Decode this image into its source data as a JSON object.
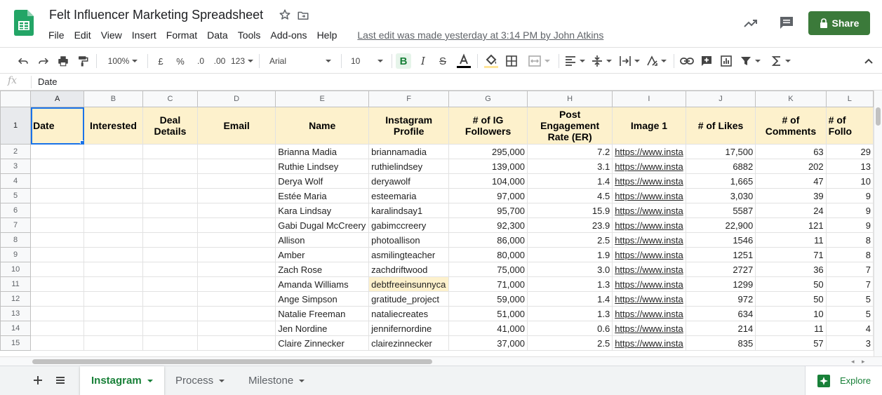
{
  "doc": {
    "title": "Felt Influencer Marketing Spreadsheet",
    "last_edit": "Last edit was made yesterday at 3:14 PM by John Atkins",
    "share_label": "Share"
  },
  "menu": [
    "File",
    "Edit",
    "View",
    "Insert",
    "Format",
    "Data",
    "Tools",
    "Add-ons",
    "Help"
  ],
  "toolbar": {
    "zoom": "100%",
    "currency": "£",
    "percent": "%",
    "dec_less": ".0",
    "dec_more": ".00",
    "more_formats": "123",
    "font": "Arial",
    "font_size": "10"
  },
  "formula_bar": {
    "fx": "fx",
    "value": "Date"
  },
  "columns": [
    "A",
    "B",
    "C",
    "D",
    "E",
    "F",
    "G",
    "H",
    "I",
    "J",
    "K",
    "L"
  ],
  "header_row": {
    "num": "1",
    "cells": [
      "Date",
      "Interested",
      "Deal Details",
      "Email",
      "Name",
      "Instagram Profile",
      "# of IG Followers",
      "Post Engagement Rate (ER)",
      "Image 1",
      "# of Likes",
      "# of Comments",
      "# of Follo"
    ]
  },
  "rows": [
    {
      "num": "2",
      "name": "Brianna Madia",
      "profile": "briannamadia",
      "followers": "295,000",
      "er": "7.2",
      "image": "https://www.insta",
      "likes": "17,500",
      "comments": "63",
      "l": "29"
    },
    {
      "num": "3",
      "name": "Ruthie Lindsey",
      "profile": "ruthielindsey",
      "followers": "139,000",
      "er": "3.1",
      "image": "https://www.insta",
      "likes": "6882",
      "comments": "202",
      "l": "13"
    },
    {
      "num": "4",
      "name": "Derya Wolf",
      "profile": "deryawolf",
      "followers": "104,000",
      "er": "1.4",
      "image": "https://www.insta",
      "likes": "1,665",
      "comments": "47",
      "l": "10"
    },
    {
      "num": "5",
      "name": "Estée Maria",
      "profile": "esteemaria",
      "followers": "97,000",
      "er": "4.5",
      "image": "https://www.insta",
      "likes": "3,030",
      "comments": "39",
      "l": "9"
    },
    {
      "num": "6",
      "name": "Kara Lindsay",
      "profile": "karalindsay1",
      "followers": "95,700",
      "er": "15.9",
      "image": "https://www.insta",
      "likes": "5587",
      "comments": "24",
      "l": "9"
    },
    {
      "num": "7",
      "name": "Gabi Dugal McCreery",
      "profile": "gabimccreery",
      "followers": "92,300",
      "er": "23.9",
      "image": "https://www.insta",
      "likes": "22,900",
      "comments": "121",
      "l": "9"
    },
    {
      "num": "8",
      "name": "Allison",
      "profile": "photoallison",
      "followers": "86,000",
      "er": "2.5",
      "image": "https://www.insta",
      "likes": "1546",
      "comments": "11",
      "l": "8"
    },
    {
      "num": "9",
      "name": "Amber",
      "profile": "asmilingteacher",
      "followers": "80,000",
      "er": "1.9",
      "image": "https://www.insta",
      "likes": "1251",
      "comments": "71",
      "l": "8"
    },
    {
      "num": "10",
      "name": "Zach Rose",
      "profile": "zachdriftwood",
      "followers": "75,000",
      "er": "3.0",
      "image": "https://www.insta",
      "likes": "2727",
      "comments": "36",
      "l": "7"
    },
    {
      "num": "11",
      "name": "Amanda Williams",
      "profile": "debtfreeinsunnyca",
      "followers": "71,000",
      "er": "1.3",
      "image": "https://www.insta",
      "likes": "1299",
      "comments": "50",
      "l": "7"
    },
    {
      "num": "12",
      "name": "Ange Simpson",
      "profile": "gratitude_project",
      "followers": "59,000",
      "er": "1.4",
      "image": "https://www.insta",
      "likes": "972",
      "comments": "50",
      "l": "5"
    },
    {
      "num": "13",
      "name": "Natalie Freeman",
      "profile": "nataliecreates",
      "followers": "51,000",
      "er": "1.3",
      "image": "https://www.insta",
      "likes": "634",
      "comments": "10",
      "l": "5"
    },
    {
      "num": "14",
      "name": "Jen Nordine",
      "profile": "jennifernordine",
      "followers": "41,000",
      "er": "0.6",
      "image": "https://www.insta",
      "likes": "214",
      "comments": "11",
      "l": "4"
    },
    {
      "num": "15",
      "name": "Claire Zinnecker",
      "profile": "clairezinnecker",
      "followers": "37,000",
      "er": "2.5",
      "image": "https://www.insta",
      "likes": "835",
      "comments": "57",
      "l": "3"
    }
  ],
  "sheets": [
    "Instagram",
    "Process",
    "Milestone"
  ],
  "explore_label": "Explore",
  "colors": {
    "share": "#3b7a3a",
    "header_fill": "#fdf1cc",
    "active_tab": "#188038",
    "selection": "#1a73e8",
    "link": "#1155cc"
  }
}
